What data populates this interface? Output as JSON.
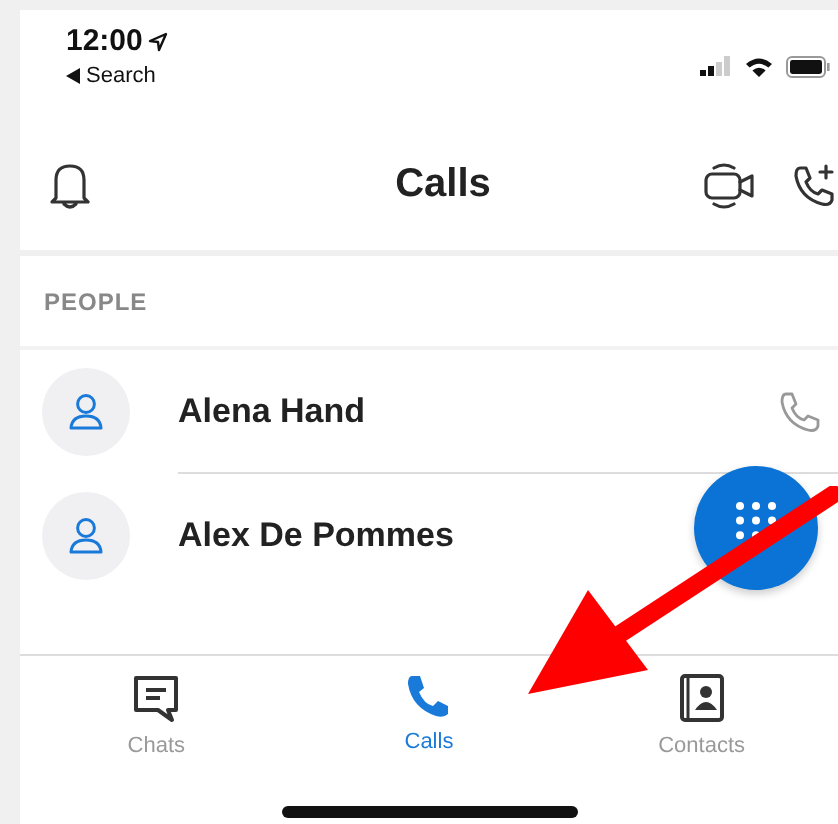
{
  "status_bar": {
    "time": "12:00",
    "back_label": "Search"
  },
  "header": {
    "title": "Calls"
  },
  "section": {
    "label": "PEOPLE"
  },
  "contacts": [
    {
      "name": "Alena Hand",
      "kind": "person",
      "call_button": true
    },
    {
      "name": "Alex De Pommes",
      "kind": "person",
      "call_button": false
    }
  ],
  "tabs": [
    {
      "label": "Chats",
      "kind": "chat",
      "selected": false
    },
    {
      "label": "Calls",
      "kind": "call",
      "selected": true
    },
    {
      "label": "Contacts",
      "kind": "contacts",
      "selected": false
    }
  ]
}
